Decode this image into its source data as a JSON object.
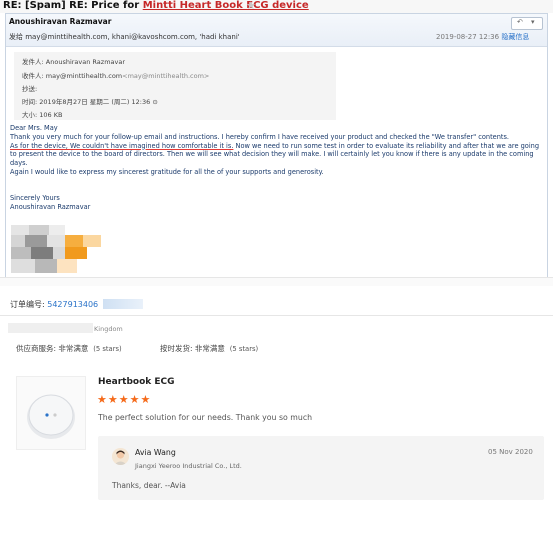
{
  "email": {
    "subject_prefix": "RE: [Spam] RE: Price for ",
    "subject_highlight": "Mintti Heart Book ECG device",
    "sender_name": "Anoushiravan Razmavar",
    "to_label": "发给",
    "to_value": "may@minttihealth.com, khani@kavoshcom.com, 'hadi khani'",
    "date": "2019-08-27 12:36",
    "collapse_label": "隐藏信息",
    "meta": {
      "from_label": "发件人:",
      "from_value": "Anoushiravan Razmavar",
      "recipient_label": "收件人:",
      "recipient_value": "may@minttihealth.com",
      "recipient_addr": "<may@minttihealth.com>",
      "cc_label": "抄送:",
      "time_label": "时间:",
      "time_value": "2019年8月27日 星期二 (周二) 12:36",
      "size_label": "大小:",
      "size_value": "106 KB"
    },
    "greeting": "Dear Mrs. May",
    "para1": "Thank you very much for your follow-up email and instructions. I hereby confirm I have received your product and checked the \"We transfer\" contents.",
    "para2_highlight": "As for the device, We couldn't have imagined how comfortable it is.",
    "para2_rest": " Now we need to run some test in order to evaluate its reliability and after that we are going to present the device to the board of directors. Then we will see what decision they will make. I will certainly let you know if there is any update in the coming days.",
    "para3": "Again I would like to express my sincerest gratitude for all the of your supports and generosity.",
    "closing": "Sincerely Yours",
    "closing_name": "Anoushiravan Razmavar"
  },
  "order": {
    "label": "订单编号:",
    "number": "5427913406"
  },
  "buyer": {
    "country": "Kingdom"
  },
  "ratings": {
    "supplier_label": "供应商服务:",
    "supplier_value": "非常满意",
    "supplier_stars": "(5 stars)",
    "shipping_label": "按时发货:",
    "shipping_value": "非常满意",
    "shipping_stars": "(5 stars)"
  },
  "product": {
    "name": "Heartbook ECG",
    "rating": 5,
    "stars": "★★★★★",
    "review": "The perfect solution for our needs. Thank you so much"
  },
  "reply": {
    "name": "Avia Wang",
    "company": "Jiangxi Yeeroo Industrial Co., Ltd.",
    "date": "05 Nov 2020",
    "text": "Thanks, dear. --Avia"
  },
  "colors": {
    "accent_link": "#2a73c9",
    "star": "#f56a1a",
    "highlight_red": "#c62828"
  }
}
